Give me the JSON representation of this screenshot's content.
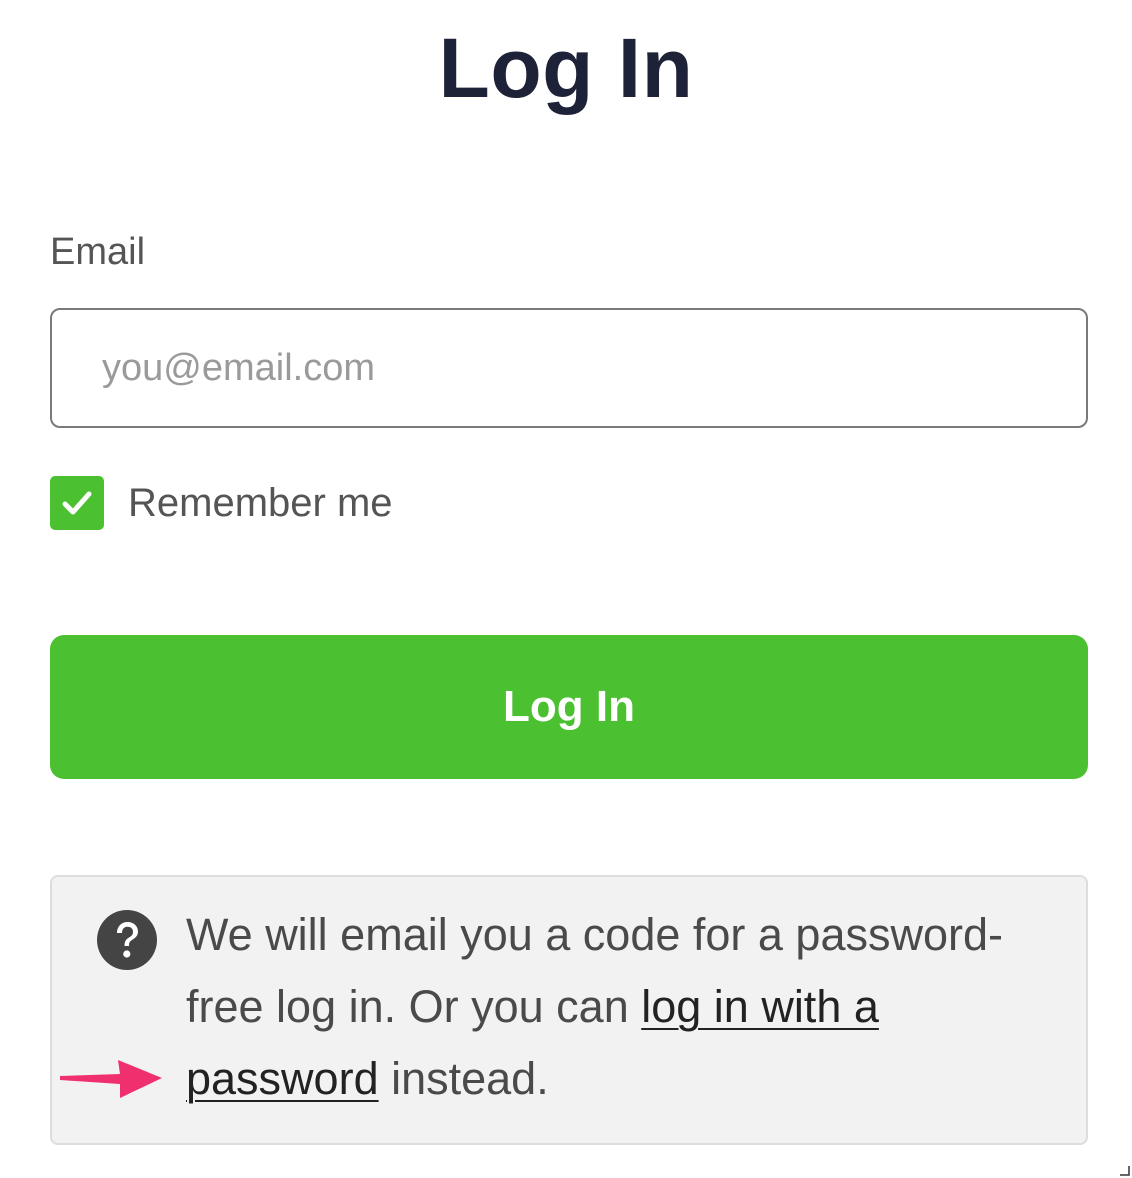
{
  "page": {
    "title": "Log In"
  },
  "form": {
    "email_label": "Email",
    "email_placeholder": "you@email.com",
    "email_value": "",
    "remember_label": "Remember me",
    "remember_checked": true,
    "submit_label": "Log In"
  },
  "info": {
    "icon": "question-circle-icon",
    "text_before_link": "We will email you a code for a password-free log in. Or you can ",
    "link_text": "log in with a password",
    "text_after_link": " instead."
  },
  "annotation": {
    "arrow_icon": "pink-arrow-icon",
    "arrow_color": "#f0306e"
  },
  "colors": {
    "accent_green": "#4bc132",
    "title_color": "#1e2238",
    "info_background": "#f2f2f2"
  }
}
